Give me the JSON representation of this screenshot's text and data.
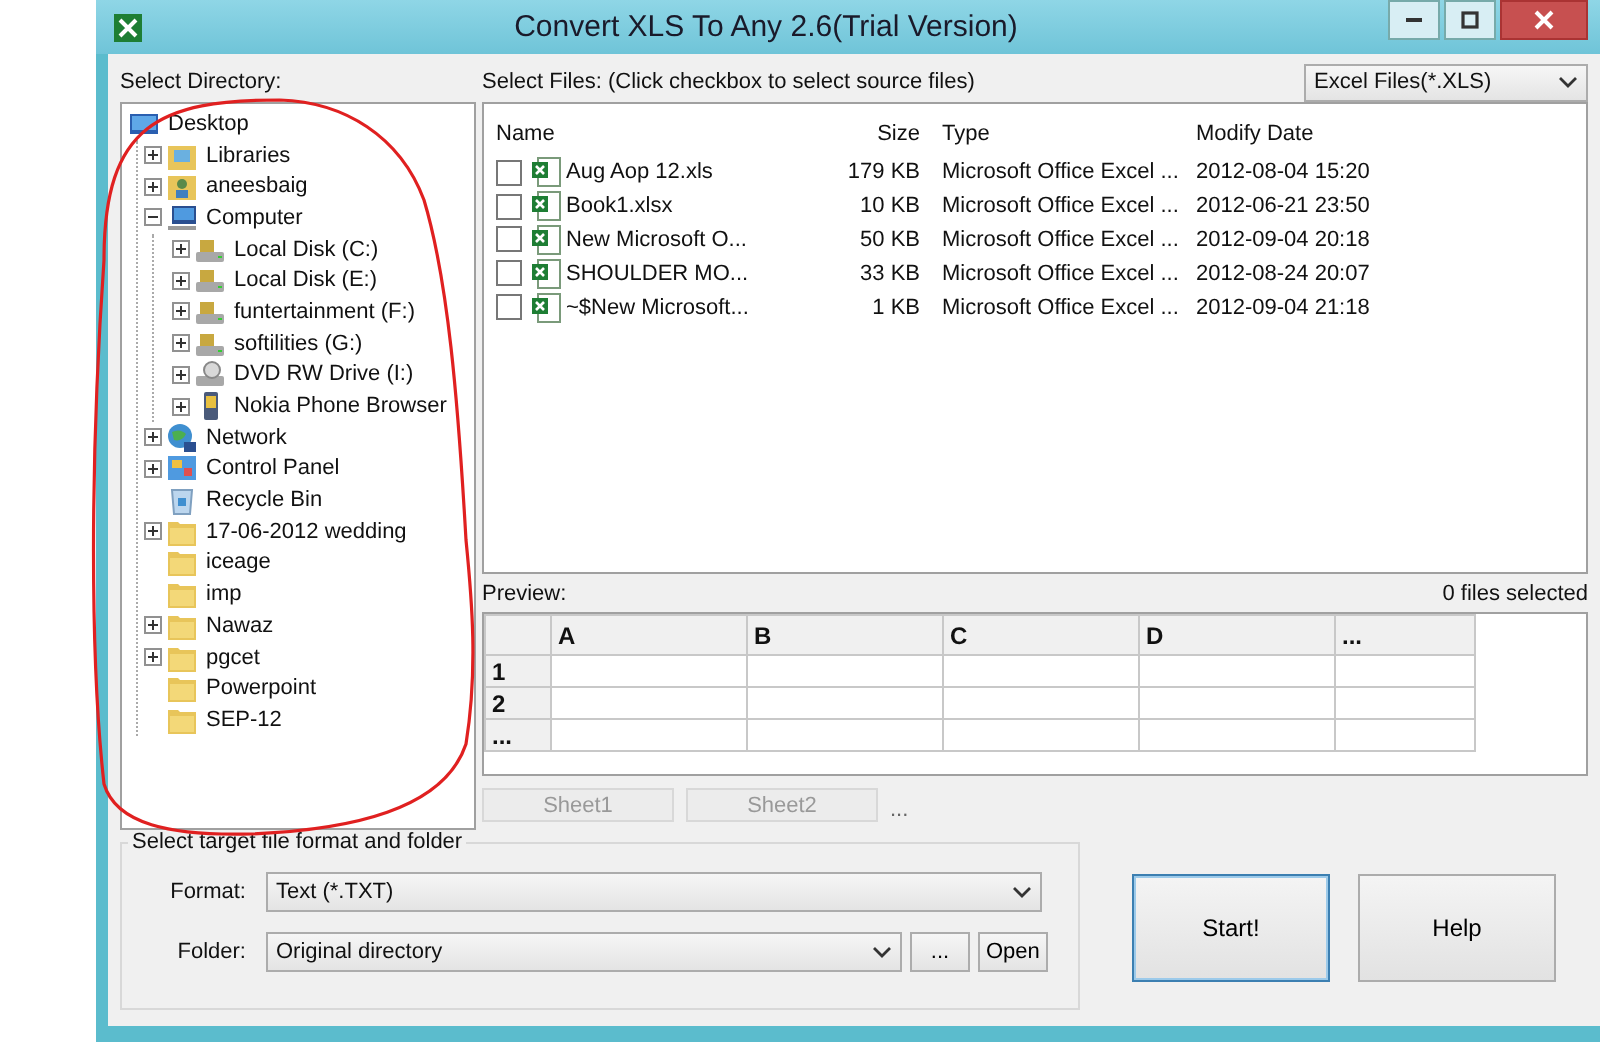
{
  "window": {
    "title": "Convert XLS To Any 2.6(Trial Version)"
  },
  "directory": {
    "label": "Select Directory:",
    "tree": {
      "label": "Desktop",
      "kind": "desktop",
      "children": [
        {
          "label": "Libraries",
          "kind": "library",
          "expanded": false
        },
        {
          "label": "aneesbaig",
          "kind": "user",
          "expanded": false
        },
        {
          "label": "Computer",
          "kind": "computer",
          "expanded": true,
          "children": [
            {
              "label": "Local Disk (C:)",
              "kind": "drive",
              "expanded": false
            },
            {
              "label": "Local Disk (E:)",
              "kind": "drive",
              "expanded": false
            },
            {
              "label": "funtertainment (F:)",
              "kind": "drive",
              "expanded": false
            },
            {
              "label": "softilities (G:)",
              "kind": "drive",
              "expanded": false
            },
            {
              "label": "DVD RW Drive (I:)",
              "kind": "dvd",
              "expanded": false
            },
            {
              "label": "Nokia Phone Browser",
              "kind": "phone",
              "expanded": false
            }
          ]
        },
        {
          "label": "Network",
          "kind": "network",
          "expanded": false
        },
        {
          "label": "Control Panel",
          "kind": "control",
          "expanded": false
        },
        {
          "label": "Recycle Bin",
          "kind": "recycle"
        },
        {
          "label": "17-06-2012 wedding",
          "kind": "folder",
          "expanded": false
        },
        {
          "label": "iceage",
          "kind": "folder"
        },
        {
          "label": "imp",
          "kind": "folder"
        },
        {
          "label": "Nawaz",
          "kind": "folder",
          "expanded": false
        },
        {
          "label": "pgcet",
          "kind": "folder",
          "expanded": false
        },
        {
          "label": "Powerpoint",
          "kind": "folder"
        },
        {
          "label": "SEP-12",
          "kind": "folder"
        }
      ]
    }
  },
  "files": {
    "label": "Select Files: (Click checkbox to select source files)",
    "filter": "Excel Files(*.XLS)",
    "columns": [
      "Name",
      "Size",
      "Type",
      "Modify Date"
    ],
    "rows": [
      {
        "checked": false,
        "name": "Aug Aop 12.xls",
        "size": "179 KB",
        "type": "Microsoft Office Excel ...",
        "date": "2012-08-04 15:20"
      },
      {
        "checked": false,
        "name": "Book1.xlsx",
        "size": "10 KB",
        "type": "Microsoft Office Excel ...",
        "date": "2012-06-21 23:50"
      },
      {
        "checked": false,
        "name": "New Microsoft O...",
        "size": "50 KB",
        "type": "Microsoft Office Excel ...",
        "date": "2012-09-04 20:18"
      },
      {
        "checked": false,
        "name": "SHOULDER MO...",
        "size": "33 KB",
        "type": "Microsoft Office Excel ...",
        "date": "2012-08-24 20:07"
      },
      {
        "checked": false,
        "name": "~$New Microsoft...",
        "size": "1 KB",
        "type": "Microsoft Office Excel ...",
        "date": "2012-09-04 21:18"
      }
    ]
  },
  "preview": {
    "label": "Preview:",
    "status": "0 files selected",
    "columns": [
      "A",
      "B",
      "C",
      "D",
      "..."
    ],
    "rows": [
      "1",
      "2",
      "..."
    ],
    "sheets": [
      {
        "label": "Sheet1",
        "disabled": true
      },
      {
        "label": "Sheet2",
        "disabled": true
      }
    ],
    "more": "..."
  },
  "target": {
    "label": "Select target file format and folder",
    "format_label": "Format:",
    "format": "Text (*.TXT)",
    "folder_label": "Folder:",
    "folder": "Original directory",
    "browse": "...",
    "open": "Open"
  },
  "buttons": [
    {
      "label": "Start!",
      "default": true
    },
    {
      "label": "Help",
      "default": false
    }
  ]
}
